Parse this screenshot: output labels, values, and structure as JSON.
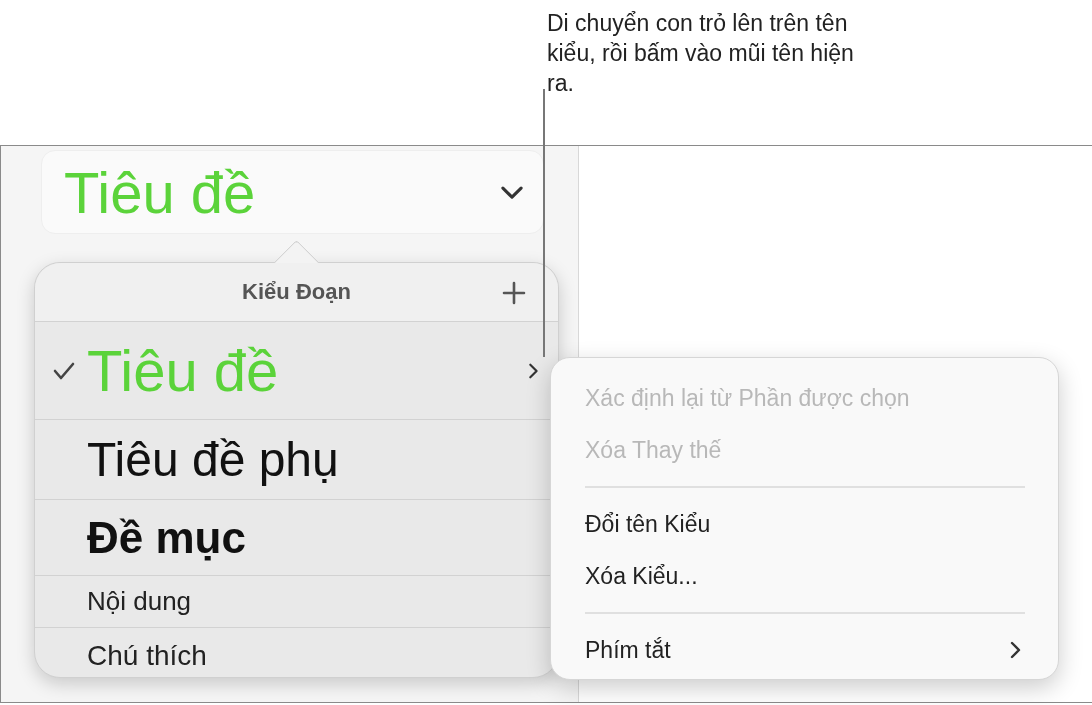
{
  "callout": {
    "text": "Di chuyển con trỏ lên trên tên kiểu, rồi bấm vào mũi tên hiện ra."
  },
  "style_button": {
    "label": "Tiêu đề"
  },
  "paragraph_styles": {
    "title": "Kiểu Đoạn",
    "items": [
      {
        "kind": "title",
        "label": "Tiêu đề",
        "checked": true,
        "arrow": true
      },
      {
        "kind": "subtitle",
        "label": "Tiêu đề phụ",
        "checked": false,
        "arrow": false
      },
      {
        "kind": "heading",
        "label": "Đề mục",
        "checked": false,
        "arrow": false
      },
      {
        "kind": "body",
        "label": "Nội dung",
        "checked": false,
        "arrow": false
      },
      {
        "kind": "caption",
        "label": "Chú thích",
        "checked": false,
        "arrow": false
      }
    ]
  },
  "context_menu": {
    "items": [
      {
        "kind": "item",
        "label": "Xác định lại từ Phần được chọn",
        "disabled": true,
        "submenu": false
      },
      {
        "kind": "item",
        "label": "Xóa Thay thế",
        "disabled": true,
        "submenu": false
      },
      {
        "kind": "separator"
      },
      {
        "kind": "item",
        "label": "Đổi tên Kiểu",
        "disabled": false,
        "submenu": false
      },
      {
        "kind": "item",
        "label": "Xóa Kiểu...",
        "disabled": false,
        "submenu": false
      },
      {
        "kind": "separator"
      },
      {
        "kind": "item",
        "label": "Phím tắt",
        "disabled": false,
        "submenu": true
      }
    ]
  }
}
